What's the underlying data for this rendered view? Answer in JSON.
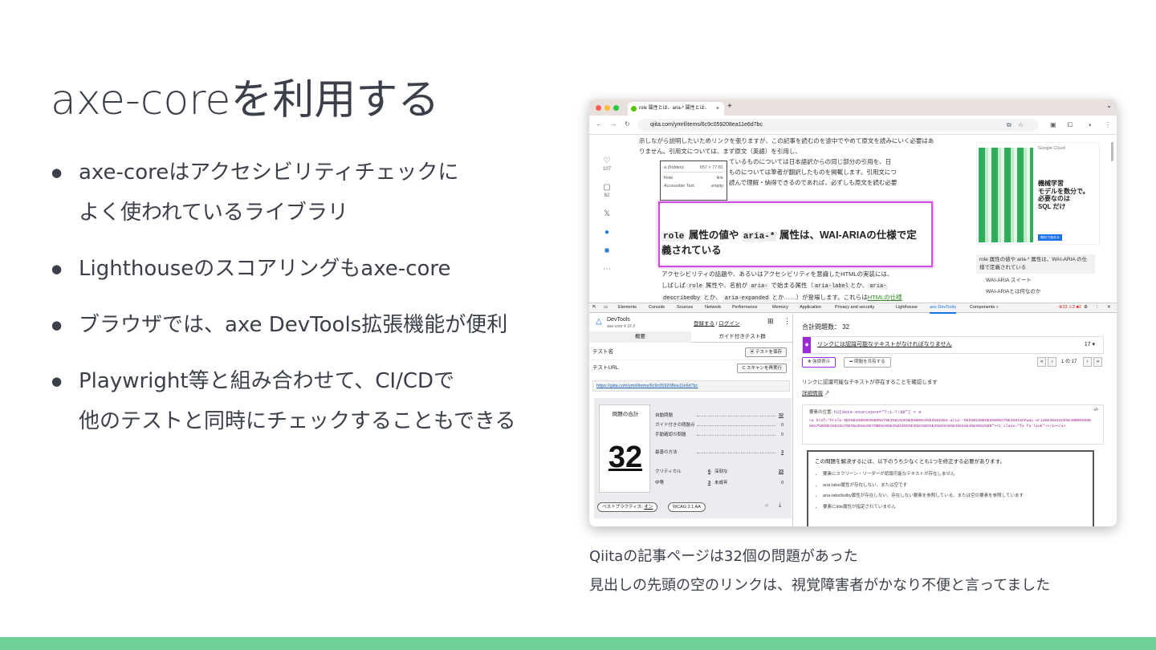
{
  "slide": {
    "title": "axe-coreを利用する",
    "bullets": [
      {
        "lines": [
          "axe-coreはアクセシビリティチェックに",
          "よく使われているライブラリ"
        ]
      },
      {
        "lines": [
          "Lighthouseのスコアリングもaxe-core"
        ]
      },
      {
        "lines": [
          "ブラウザでは、axe DevTools拡張機能が便利"
        ]
      },
      {
        "lines": [
          "Playwright等と組み合わせて、CI/CDで",
          "他のテストと同時にチェックすることもできる"
        ]
      }
    ],
    "caption": [
      "Qiitaの記事ページは32個の問題があった",
      "見出しの先頭の空のリンクは、視覚障害者がかなり不便と言ってました"
    ],
    "accent_color": "#6fcf97"
  },
  "browser": {
    "tab_title": "role 属性とは、aria-* 属性とは、",
    "url": "qiita.com/ymrl/items/6c9c059208ea11e6d7bc",
    "traffic_colors": [
      "#ff5f57",
      "#febc2e",
      "#28c840"
    ]
  },
  "article": {
    "sidebar": {
      "likes": "107",
      "stocks": "82"
    },
    "para1": "示しながら説明したいためリンクを張りますが、この記事を読むのを途中でやめて原文を読みにいく必要はありません。引用文については、まず原文（英語）を引用し、",
    "para1b": "ているものについては日本語訳からの同じ部分の引用を、日",
    "para1c": "ものについては筆者が翻訳したものを掲載します。引用文につ",
    "para1d": "読んで理解・納得できるのであれば、必ずしも原文を読む必要",
    "tooltip": {
      "tag": "a",
      "state": "(hidden)",
      "size": "657 × 77.81",
      "role_label": "Role",
      "role_value": "link",
      "acc_label": "Accessible Text",
      "acc_value": "empty"
    },
    "heading_code1": "role",
    "heading_mid": " 属性の値や ",
    "heading_code2": "aria-*",
    "heading_end": " 属性は、WAI-ARIAの仕様で定",
    "heading_line2": "義されている",
    "para2_l1": "アクセシビリティの話題や、あるいはアクセシビリティを意識したHTMLの実装には、",
    "para2_a": "しばしば ",
    "para2_c1": "role",
    "para2_b": " 属性や、名前が ",
    "para2_c2": "aria-",
    "para2_c": " で始まる属性（",
    "para2_c3": "aria-label",
    "para2_d": "とか、",
    "para2_c4": "aria-",
    "para2_l3a": "describedby",
    "para2_l3b": " とか、 ",
    "para2_c5": "aria-expanded",
    "para2_l3c": " とか……）が登場します。これらは",
    "para2_link": "HTMLの仕様",
    "ad": {
      "brand": "Google Cloud",
      "text": "機械学習\nモデルを数分で。\n必要なのは\nSQL だけ",
      "button": "無料で始める"
    },
    "toc": {
      "item1": "role 属性の値や aria-* 属性は、WAI-ARIA の仕様で定義されている",
      "item2": "WAI-ARIA スイート",
      "item3": "WAI-ARIAとは何なのか"
    }
  },
  "devtools": {
    "tabs": [
      "Elements",
      "Console",
      "Sources",
      "Network",
      "Performance",
      "Memory",
      "Application",
      "Privacy and security",
      "Lighthouse",
      "axe DevTools",
      "Components »"
    ],
    "active_tab": "axe DevTools",
    "errors": "⊗33 ⚠2 ■2",
    "axe": {
      "brand": "DevTools",
      "version": "axe-core 4.10.3",
      "signup": "登録する",
      "sep": " / ",
      "login": "ログイン",
      "tab_overview": "概要",
      "tab_guided": "ガイド付きテスト群",
      "test_name_label": "テスト名",
      "save_button": "テストを保存",
      "test_url_label": "テストURL",
      "rescan_button": "C スキャンを再実行",
      "test_url": "https://qiita.com/ymrl/items/6c9c059208ea11e6d7bc",
      "summary_label": "問題の合計",
      "total_issues": "32",
      "rows": [
        {
          "label": "自動問題",
          "value": "32"
        },
        {
          "label": "ガイド付きの問題点",
          "value": "0"
        },
        {
          "label": "手動確認の問題",
          "value": "0"
        },
        {
          "label": "最善の方法",
          "value": "3"
        }
      ],
      "severity": {
        "critical_label": "クリティカル",
        "critical": "6",
        "serious_label": "深刻な",
        "serious": "23",
        "moderate_label": "中等",
        "moderate": "3",
        "minor_label": "未成年",
        "minor": "0"
      },
      "best_practice_label": "ベストプラクティス:",
      "best_practice_value": "オン",
      "wcag": "WCAG 2.1 AA",
      "issues_total": "合計問題数： 32",
      "issue_title": "リンクには認識可能なテキストがなければなりません",
      "issue_count": "17",
      "highlight_button": "強調表示",
      "share_button": "問題を共有する",
      "pager": "1 の 17",
      "desc": "リンクに認識可能なテキストが存在することを確認します",
      "more_info": "詳細情報",
      "element_location_label": "要素の位置:",
      "element_location": "h2[data-sourcepos=\"7:1-7:88\"] > a",
      "source": "<a href=\"#role-%E5%B1%9E%E6%80%A7%E3%81%AE%E5%80%A4%E3%82%84-aria--%E5%B1%9E%E6%80%A7%E3%81%AFwai-aria%E3%81%AE%E4%BB%95%E6%A7%98%E3%81%A7%E5%AE%9A%E7%BE%A9%E3%81%95%E3%82%8C%E3%81%A6%E3%81%84%E3%82%8B\"><i class=\"fa fa-link\"></i></a>",
      "fix_title": "この問題を解決するには、以下のうち少なくとも1つを修正する必要があります。",
      "fix_items": [
        "要素にスクリーン・リーダーが認識可能なテキストが存在しません",
        "aria-label属性が存在しない、または空です",
        "aria-labelledby属性が存在しない、存在しない要素を参照している、または空の要素を参照しています",
        "要素にtitle属性が指定されていません"
      ]
    }
  }
}
